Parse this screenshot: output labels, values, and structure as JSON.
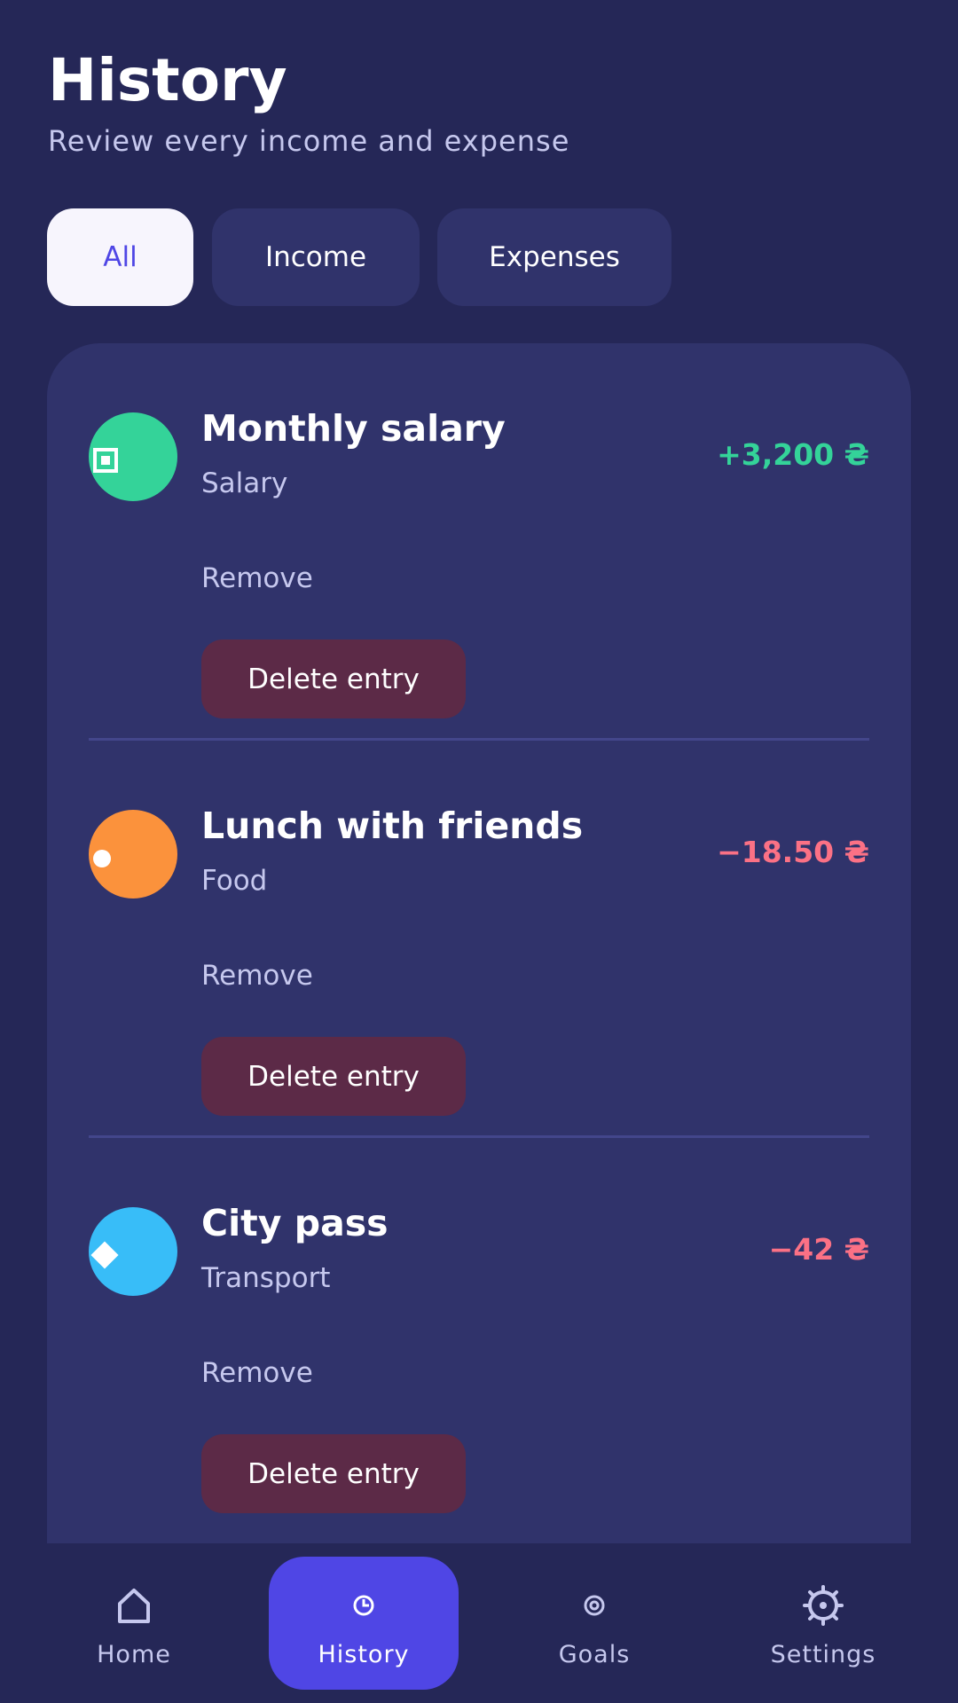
{
  "header": {
    "title": "History",
    "subtitle": "Review every income and expense"
  },
  "filters": {
    "tabs": [
      {
        "label": "All",
        "active": true
      },
      {
        "label": "Income",
        "active": false
      },
      {
        "label": "Expenses",
        "active": false
      }
    ]
  },
  "entries": [
    {
      "title": "Monthly salary",
      "category": "Salary",
      "amount": "+3,200 ₴",
      "amount_color": "#34d399",
      "icon": "salary-icon",
      "icon_color": "#34d399",
      "remove_label": "Remove",
      "delete_label": "Delete entry"
    },
    {
      "title": "Lunch with friends",
      "category": "Food",
      "amount": "−18.50 ₴",
      "amount_color": "#fb7185",
      "icon": "food-icon",
      "icon_color": "#fb923c",
      "remove_label": "Remove",
      "delete_label": "Delete entry"
    },
    {
      "title": "City pass",
      "category": "Transport",
      "amount": "−42 ₴",
      "amount_color": "#fb7185",
      "icon": "transport-icon",
      "icon_color": "#38bdf8",
      "remove_label": "Remove",
      "delete_label": "Delete entry"
    }
  ],
  "nav": {
    "items": [
      {
        "label": "Home",
        "icon": "home-icon",
        "active": false
      },
      {
        "label": "History",
        "icon": "clock-icon",
        "active": true
      },
      {
        "label": "Goals",
        "icon": "target-icon",
        "active": false
      },
      {
        "label": "Settings",
        "icon": "gear-icon",
        "active": false
      }
    ]
  },
  "colors": {
    "background": "#252757",
    "surface": "#30336b",
    "accent": "#4f46e5",
    "danger_button": "#5c2a47",
    "income": "#34d399",
    "expense": "#fb7185"
  }
}
